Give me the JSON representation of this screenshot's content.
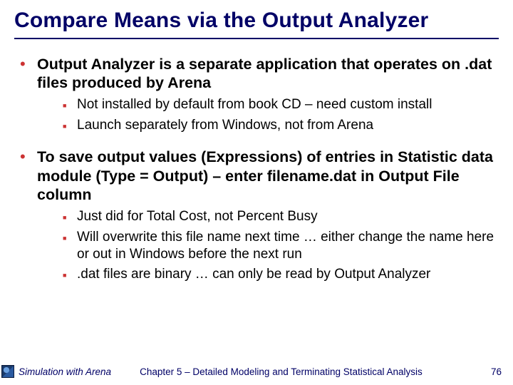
{
  "title": "Compare Means via the Output Analyzer",
  "bullets": [
    {
      "text": "Output Analyzer is a separate application that operates on .dat files produced by Arena",
      "sub": [
        "Not installed by default from book CD – need custom install",
        "Launch separately from Windows, not from Arena"
      ]
    },
    {
      "text": "To save output values (Expressions) of entries in Statistic data module (Type = Output) – enter filename.dat in Output File column",
      "sub": [
        "Just did for Total Cost, not Percent Busy",
        "Will overwrite this file name next time … either change the name here or out in Windows before the next run",
        ".dat files are binary … can only be read by Output Analyzer"
      ]
    }
  ],
  "footer": {
    "book": "Simulation with Arena",
    "chapter": "Chapter 5 – Detailed Modeling and Terminating Statistical Analysis",
    "page": "76"
  }
}
